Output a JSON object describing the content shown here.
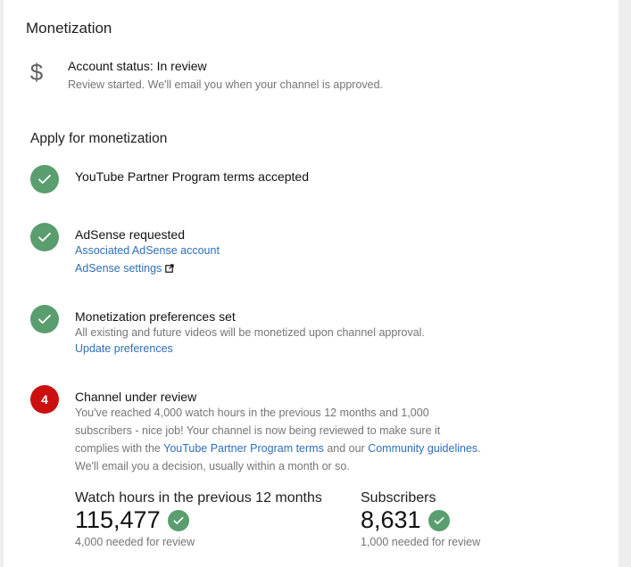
{
  "header": {
    "title": "Monetization"
  },
  "account_status": {
    "icon": "dollar-icon",
    "label": "Account status: In review",
    "sub": "Review started. We'll email you when your channel is approved."
  },
  "apply": {
    "title": "Apply for monetization",
    "steps": [
      {
        "state": "done",
        "title": "YouTube Partner Program terms accepted"
      },
      {
        "state": "done",
        "title": "AdSense requested",
        "link1": "Associated AdSense account",
        "link2": "AdSense settings"
      },
      {
        "state": "done",
        "title": "Monetization preferences set",
        "text": "All existing and future videos will be monetized upon channel approval.",
        "link1": "Update preferences"
      },
      {
        "state": "current",
        "number": "4",
        "title": "Channel under review",
        "line1": "You've reached 4,000 watch hours in the previous 12 months and 1,000",
        "line2": "subscribers - nice job! Your channel is now being reviewed to make sure it",
        "line3_pre": "complies with the ",
        "line3_link1": "YouTube Partner Program terms",
        "line3_mid": " and our ",
        "line3_link2": "Community guidelines",
        "line3_post": ".",
        "line4": "We'll email you a decision, usually within a month or so."
      }
    ]
  },
  "stats": {
    "watch_hours": {
      "label": "Watch hours in the previous 12 months",
      "value": "115,477",
      "note": "4,000 needed for review"
    },
    "subscribers": {
      "label": "Subscribers",
      "value": "8,631",
      "note": "1,000 needed for review"
    }
  },
  "colors": {
    "check_green": "#5a9e6f",
    "step_red": "#cc1010",
    "link_blue": "#2f6fb7"
  }
}
